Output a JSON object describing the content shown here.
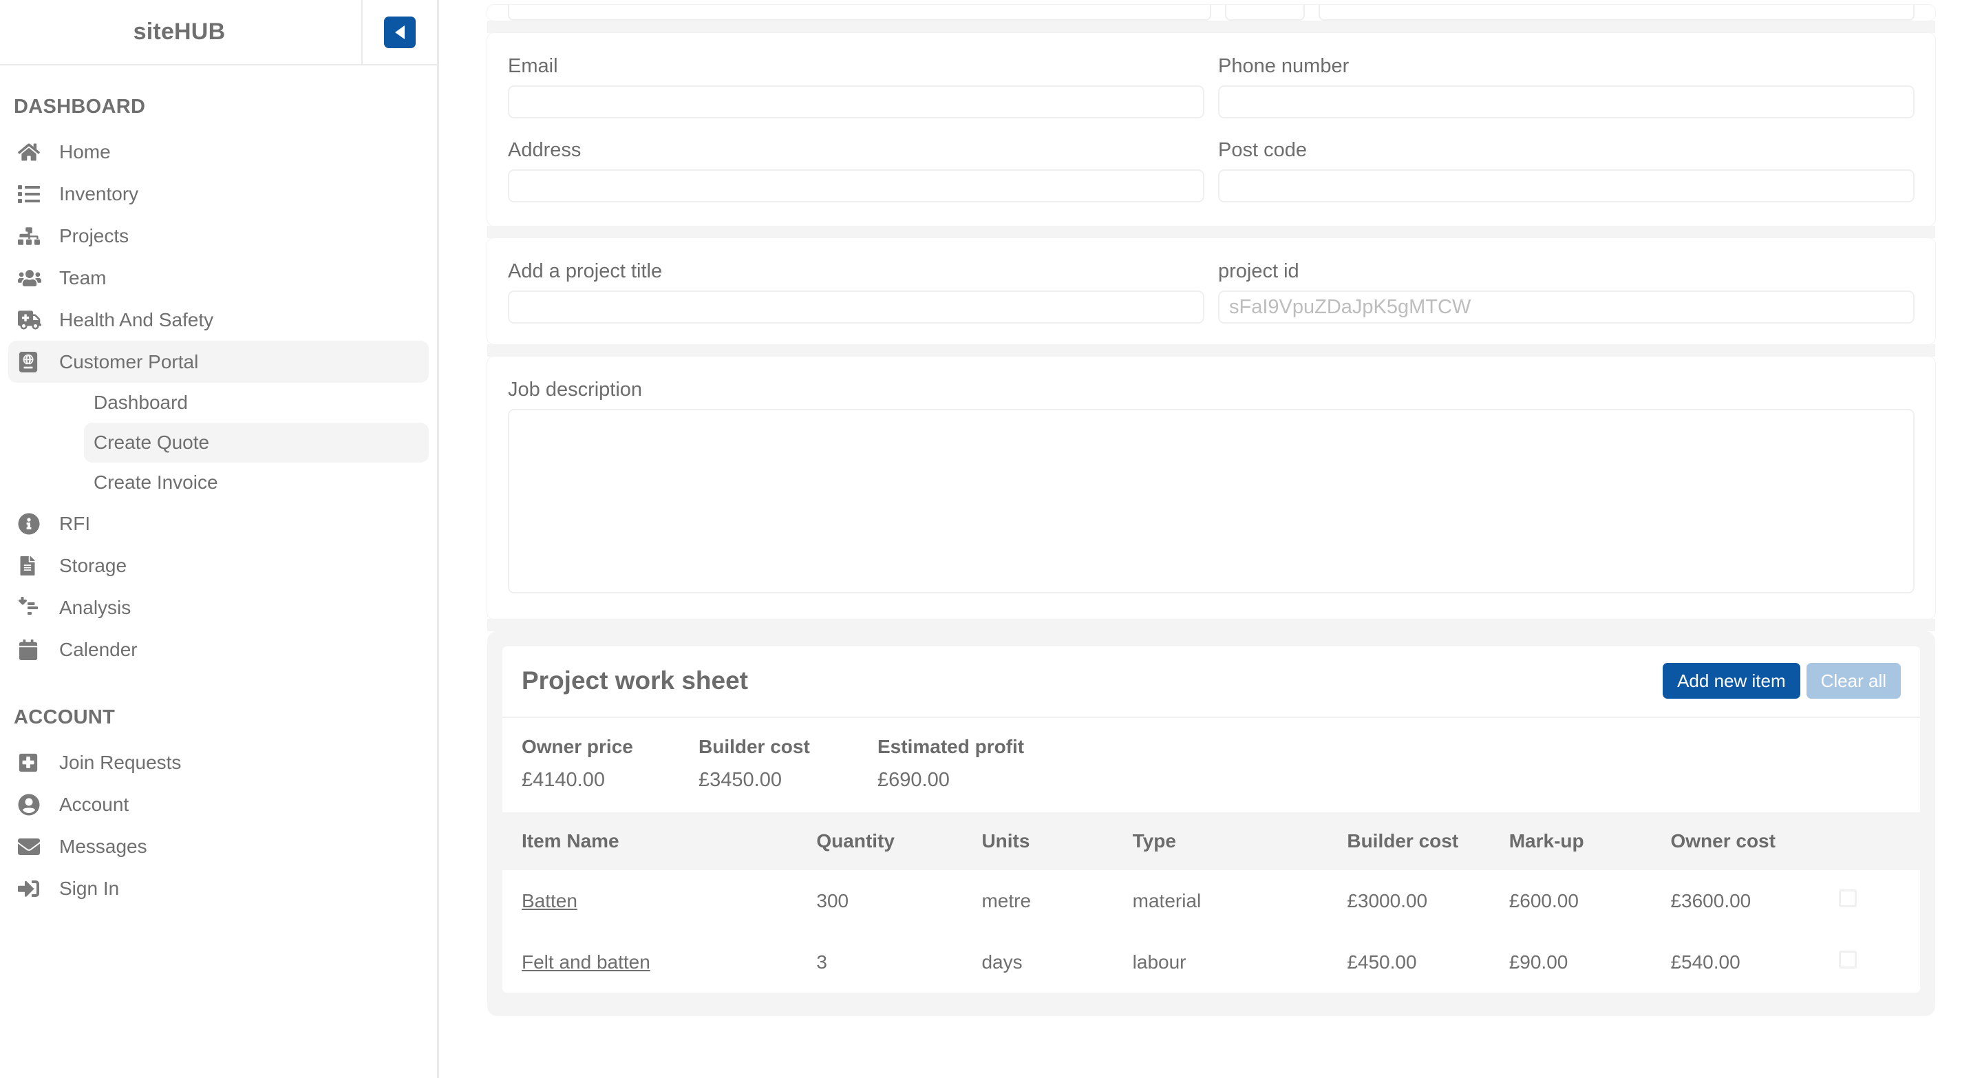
{
  "brand": {
    "name": "siteHUB",
    "collapse_icon": "chevron-left-icon",
    "accent": "#0b57a4"
  },
  "sidebar": {
    "sections": [
      {
        "title": "DASHBOARD",
        "items": [
          {
            "label": "Home",
            "icon": "home-icon",
            "active": false
          },
          {
            "label": "Inventory",
            "icon": "list-icon",
            "active": false
          },
          {
            "label": "Projects",
            "icon": "sitemap-icon",
            "active": false
          },
          {
            "label": "Team",
            "icon": "users-icon",
            "active": false
          },
          {
            "label": "Health And Safety",
            "icon": "ambulance-icon",
            "active": false
          },
          {
            "label": "Customer Portal",
            "icon": "passport-icon",
            "active": true,
            "children": [
              {
                "label": "Dashboard",
                "active": false
              },
              {
                "label": "Create Quote",
                "active": true
              },
              {
                "label": "Create Invoice",
                "active": false
              }
            ]
          },
          {
            "label": "RFI",
            "icon": "info-circle-icon",
            "active": false
          },
          {
            "label": "Storage",
            "icon": "file-lines-icon",
            "active": false
          },
          {
            "label": "Analysis",
            "icon": "sort-amount-down-icon",
            "active": false
          },
          {
            "label": "Calender",
            "icon": "calendar-icon",
            "active": false
          }
        ]
      },
      {
        "title": "ACCOUNT",
        "items": [
          {
            "label": "Join Requests",
            "icon": "square-plus-icon",
            "active": false
          },
          {
            "label": "Account",
            "icon": "user-circle-icon",
            "active": false
          },
          {
            "label": "Messages",
            "icon": "envelope-icon",
            "active": false
          },
          {
            "label": "Sign In",
            "icon": "sign-in-icon",
            "active": false
          }
        ]
      }
    ]
  },
  "form": {
    "contact": {
      "email": {
        "label": "Email",
        "value": "",
        "placeholder": ""
      },
      "phone": {
        "label": "Phone number",
        "value": "",
        "placeholder": ""
      },
      "address": {
        "label": "Address",
        "value": "",
        "placeholder": ""
      },
      "postcode": {
        "label": "Post code",
        "value": "",
        "placeholder": ""
      }
    },
    "project": {
      "title": {
        "label": "Add a project title",
        "value": "",
        "placeholder": ""
      },
      "id": {
        "label": "project id",
        "value": "",
        "placeholder": "sFaI9VpuZDaJpK5gMTCW"
      }
    },
    "description": {
      "label": "Job description",
      "value": "",
      "placeholder": ""
    }
  },
  "worksheet": {
    "title": "Project work sheet",
    "add_button": "Add new item",
    "clear_button": "Clear all",
    "summary": [
      {
        "label": "Owner price",
        "value": "£4140.00"
      },
      {
        "label": "Builder cost",
        "value": "£3450.00"
      },
      {
        "label": "Estimated profit",
        "value": "£690.00"
      }
    ],
    "columns": [
      "Item Name",
      "Quantity",
      "Units",
      "Type",
      "Builder cost",
      "Mark-up",
      "Owner cost"
    ],
    "rows": [
      {
        "item": "Batten",
        "quantity": "300",
        "units": "metre",
        "type": "material",
        "builder_cost": "£3000.00",
        "markup": "£600.00",
        "owner_cost": "£3600.00",
        "selected": false
      },
      {
        "item": "Felt and batten",
        "quantity": "3",
        "units": "days",
        "type": "labour",
        "builder_cost": "£450.00",
        "markup": "£90.00",
        "owner_cost": "£540.00",
        "selected": false
      }
    ]
  }
}
